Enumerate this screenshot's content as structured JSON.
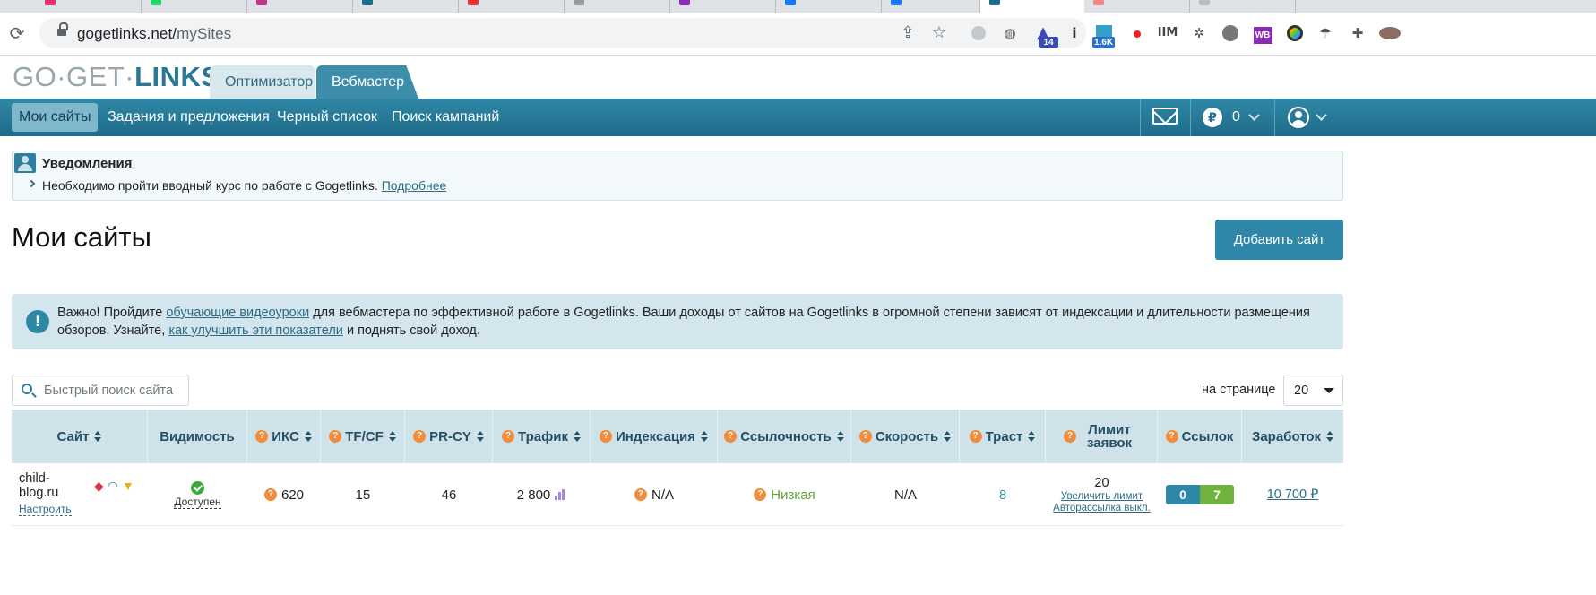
{
  "browser": {
    "url_host": "gogetlinks.net/",
    "url_path": "mySites",
    "extensions": [
      {
        "name": "gray-circle-icon"
      },
      {
        "name": "globe-icon"
      },
      {
        "name": "graduation-cap-icon",
        "badge": "14",
        "badge_color": "#3c4bb6"
      },
      {
        "name": "info-icon",
        "label": "i"
      },
      {
        "name": "stats-icon",
        "badge": "1.6K",
        "badge_color": "#2a72c9"
      },
      {
        "name": "record-icon"
      },
      {
        "name": "ilm-icon",
        "label": "IIM"
      },
      {
        "name": "tree-icon"
      },
      {
        "name": "lock-user-icon"
      },
      {
        "name": "wb-icon",
        "label": "WB",
        "color": "#8a2bb5"
      },
      {
        "name": "color-circle-icon"
      },
      {
        "name": "bird-icon"
      },
      {
        "name": "puzzle-icon"
      },
      {
        "name": "profile-avatar-icon"
      }
    ]
  },
  "header": {
    "logo_part1": "GO·GET·",
    "logo_part2": "LINKS",
    "role_tabs": [
      "Оптимизатор",
      "Вебмастер"
    ],
    "nav": [
      "Мои сайты",
      "Задания и предложения",
      "Черный список",
      "Поиск кампаний"
    ],
    "currency_symbol": "₽",
    "balance": "0"
  },
  "notifications": {
    "title": "Уведомления",
    "text": "Необходимо пройти вводный курс по работе с Gogetlinks.",
    "link": "Подробнее"
  },
  "page": {
    "title": "Мои сайты",
    "add_button": "Добавить сайт"
  },
  "info": {
    "icon": "!",
    "t1": "Важно! Пройдите ",
    "link1": "обучающие видеоуроки",
    "t2": " для вебмастера по эффективной работе в Gogetlinks. Ваши доходы от сайтов на Gogetlinks в огромной степени зависят от индексации и длительности размещения обзоров. Узнайте, ",
    "link2": "как улучшить эти показатели",
    "t3": " и поднять свой доход."
  },
  "search": {
    "placeholder": "Быстрый поиск сайта"
  },
  "perpage": {
    "label": "на странице",
    "value": "20"
  },
  "table": {
    "columns": [
      "Сайт",
      "Видимость",
      "ИКС",
      "TF/CF",
      "PR-CY",
      "Трафик",
      "Индексация",
      "Ссылочность",
      "Скорость",
      "Траст",
      "Лимит заявок",
      "Ссылок",
      "Заработок"
    ],
    "rows": [
      {
        "site": "child-blog.ru",
        "config": "Настроить",
        "visibility": "Доступен",
        "iks": "620",
        "tfcf": "15",
        "prcy": "46",
        "traffic": "2 800",
        "indexing": "N/A",
        "linkness": "Низкая",
        "speed": "N/A",
        "trust": "8",
        "limit": "20",
        "limit_action": "Увеличить лимит",
        "autosend": "Авторассылка выкл.",
        "links_blue": "0",
        "links_green": "7",
        "earnings": "10 700 ₽"
      }
    ]
  }
}
